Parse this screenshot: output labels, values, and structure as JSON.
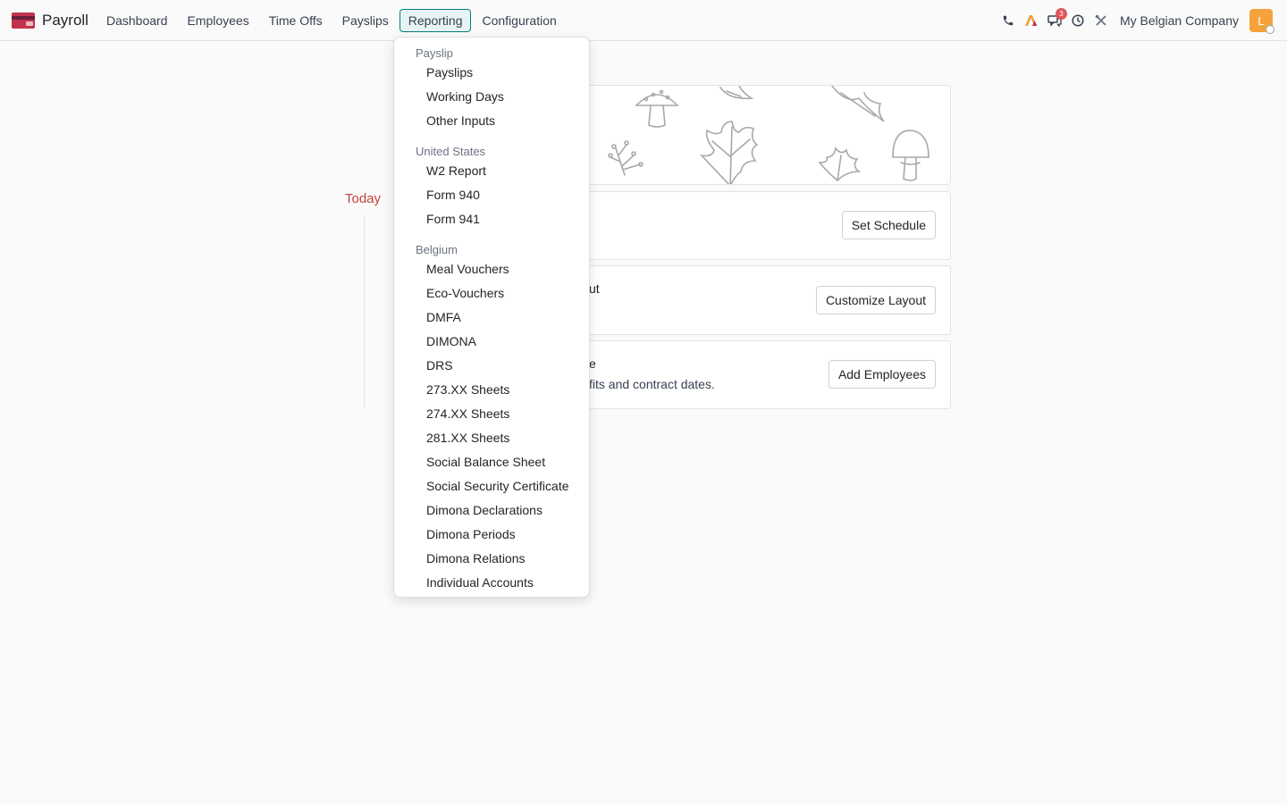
{
  "navbar": {
    "app_name": "Payroll",
    "menu": [
      "Dashboard",
      "Employees",
      "Time Offs",
      "Payslips",
      "Reporting",
      "Configuration"
    ],
    "active_menu": "Reporting",
    "notification_count": "3",
    "company": "My Belgian Company",
    "avatar_letter": "L"
  },
  "timeline": {
    "today_label": "Today"
  },
  "cards": [
    {
      "text": "",
      "subtext": "",
      "button": "Set Schedule"
    },
    {
      "text": "ut",
      "subtext": "",
      "button": "Customize Layout"
    },
    {
      "text": "e",
      "subtext": "fits and contract dates.",
      "button": "Add Employees"
    }
  ],
  "reporting_dropdown": {
    "groups": [
      {
        "header": "Payslip",
        "items": [
          "Payslips",
          "Working Days",
          "Other Inputs"
        ]
      },
      {
        "header": "United States",
        "items": [
          "W2 Report",
          "Form 940",
          "Form 941"
        ]
      },
      {
        "header": "Belgium",
        "items": [
          "Meal Vouchers",
          "Eco-Vouchers",
          "DMFA",
          "DIMONA",
          "DRS",
          "273.XX Sheets",
          "274.XX Sheets",
          "281.XX Sheets",
          "Social Balance Sheet",
          "Social Security Certificate",
          "Dimona Declarations",
          "Dimona Periods",
          "Dimona Relations",
          "Individual Accounts"
        ]
      }
    ]
  },
  "colors": {
    "active_menu_border": "#017e84",
    "today": "#c6413c",
    "badge": "#e0565a",
    "avatar": "#f4a33b"
  }
}
